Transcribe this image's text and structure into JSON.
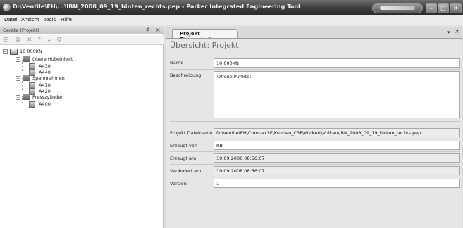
{
  "window": {
    "title": "D:\\Ventile\\EH\\...\\IBN_2008_09_19_hinten_rechts.pep - Parker Integrated Engineering Tool"
  },
  "menu": {
    "items": [
      "Datei",
      "Ansicht",
      "Tools",
      "Hilfe"
    ]
  },
  "left_panel": {
    "title": "Geräte (Projekt)",
    "pin_glyph": "⊅",
    "close_glyph": "×",
    "tree": {
      "root": "10 000KN",
      "groups": [
        {
          "label": "Obere Hubeinheit",
          "children": [
            "A430",
            "A440"
          ]
        },
        {
          "label": "Spannrahmen",
          "children": [
            "A410",
            "A420"
          ]
        },
        {
          "label": "Presszylinder",
          "children": [
            "A400"
          ]
        }
      ]
    }
  },
  "tab": {
    "label": "Projekt Eigenschaften",
    "dropdown_glyph": "▾",
    "close_glyph": "×"
  },
  "form": {
    "heading": "Übersicht: Projekt",
    "name_label": "Name",
    "name_value": "10 000KN",
    "description_label": "Beschreibung",
    "description_value": "Offene Punkte:",
    "file_label": "Projekt Dateiname",
    "file_value": "D:\\Ventile\\EH\\Compax3F\\Kunden_C3F\\Wickert\\Vulkan\\IBN_2008_09_19_hinten_rechts.pep",
    "created_by_label": "Erzeugt von",
    "created_by_value": "RB",
    "created_at_label": "Erzeugt am",
    "created_at_value": "19.09.2008 08:56:07",
    "modified_at_label": "Verändert am",
    "modified_at_value": "19.09.2008 08:56:07",
    "version_label": "Version",
    "version_value": "1"
  }
}
